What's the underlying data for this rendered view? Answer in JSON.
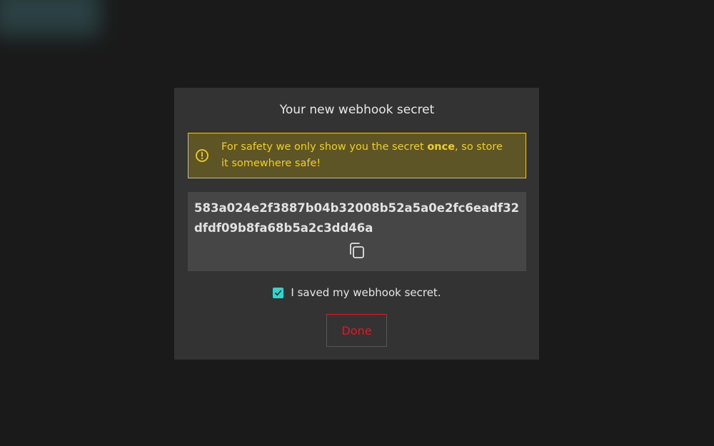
{
  "dialog": {
    "title": "Your new webhook secret",
    "warning": {
      "icon": "alert-circle-icon",
      "text_before": "For safety we only show you the secret ",
      "text_bold": "once",
      "text_after": ", so store it somewhere safe!"
    },
    "secret": {
      "value": "583a024e2f3887b04b32008b52a5a0e2fc6eadf32dfdf09b8fa68b5a2c3dd46a",
      "copy_icon": "copy-icon"
    },
    "checkbox": {
      "checked": true,
      "label": "I saved my webhook secret."
    },
    "done_label": "Done"
  },
  "colors": {
    "background": "#1a1a1a",
    "dialog": "#333333",
    "warning_fill": "#5e5526",
    "warning_accent": "#f0d01c",
    "secret_fill": "#464646",
    "checkbox": "#2fd5cf",
    "danger": "#d61d2a"
  }
}
